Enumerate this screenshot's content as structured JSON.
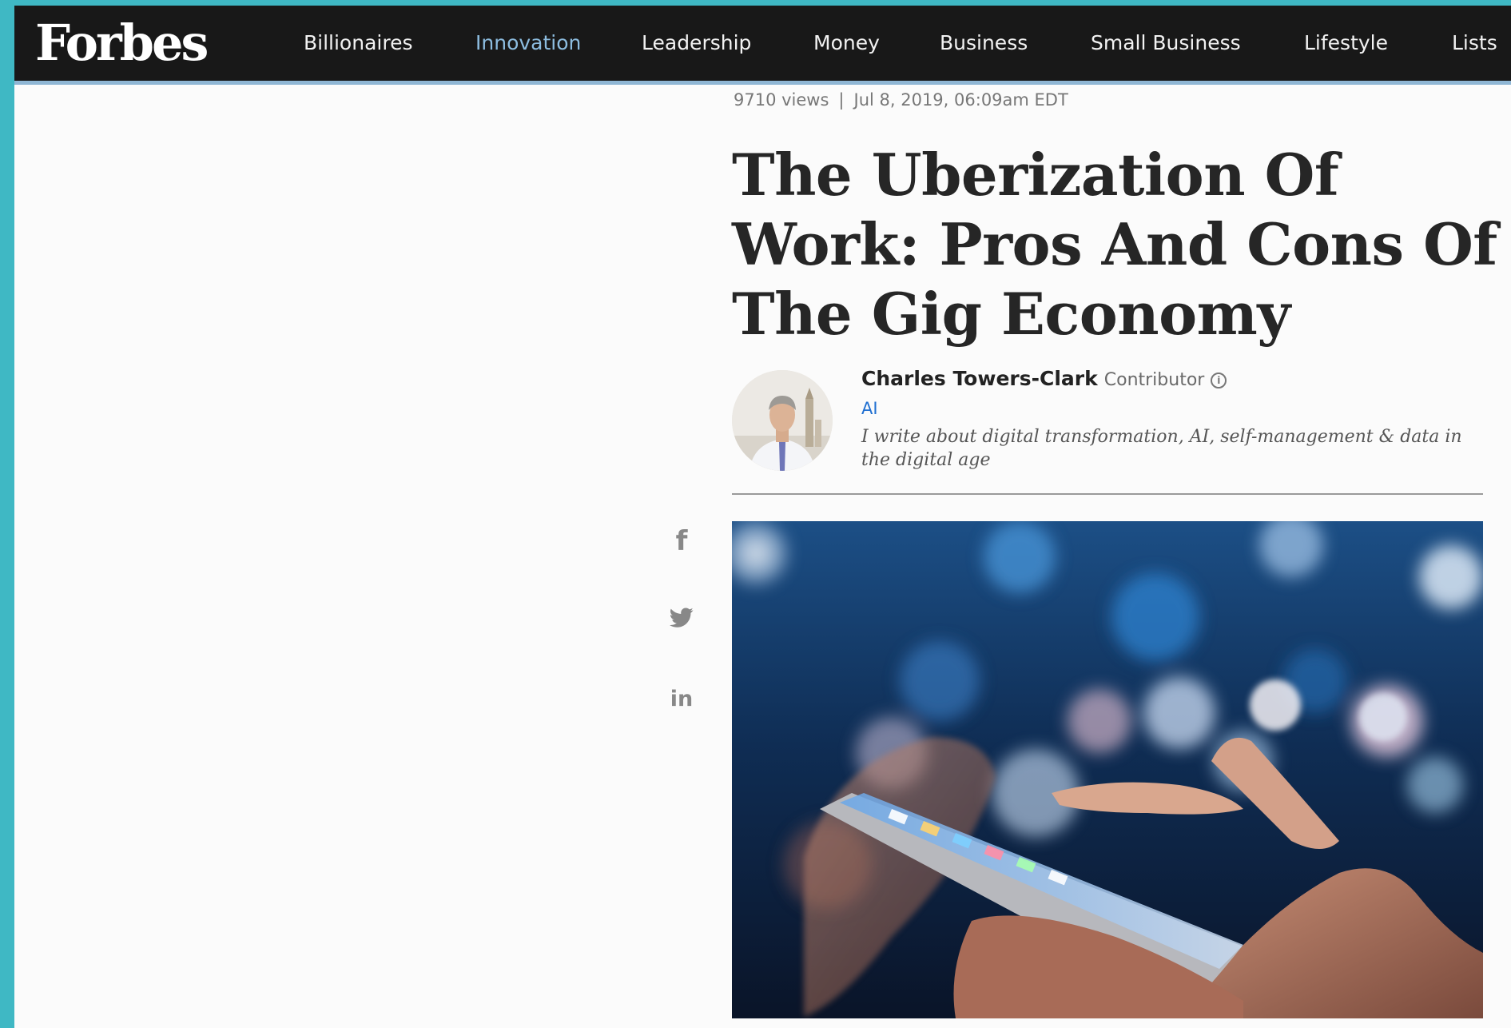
{
  "brand": {
    "logo_text": "Forbes"
  },
  "nav": {
    "items": [
      {
        "label": "Billionaires",
        "active": false
      },
      {
        "label": "Innovation",
        "active": true
      },
      {
        "label": "Leadership",
        "active": false
      },
      {
        "label": "Money",
        "active": false
      },
      {
        "label": "Business",
        "active": false
      },
      {
        "label": "Small Business",
        "active": false
      },
      {
        "label": "Lifestyle",
        "active": false
      },
      {
        "label": "Lists",
        "active": false
      }
    ],
    "active_color": "#8dbde0"
  },
  "article": {
    "views": "9710 views",
    "separator": "|",
    "date": "Jul 8, 2019, 06:09am EDT",
    "headline": "The Uberization Of Work: Pros And Cons Of The Gig Economy",
    "author": {
      "name": "Charles Towers-Clark",
      "role": "Contributor",
      "channel": "AI",
      "bio": "I write about digital transformation, AI, self-management & data in the digital age"
    },
    "hero_image": "hand-using-smartphone-bokeh-lights"
  },
  "share": {
    "icons": [
      "facebook-icon",
      "twitter-icon",
      "linkedin-icon"
    ],
    "facebook_glyph": "f",
    "linkedin_glyph": "in"
  },
  "colors": {
    "outer_background": "#3fb8c4",
    "nav_background": "#181818",
    "link_blue": "#1f6fd1"
  }
}
